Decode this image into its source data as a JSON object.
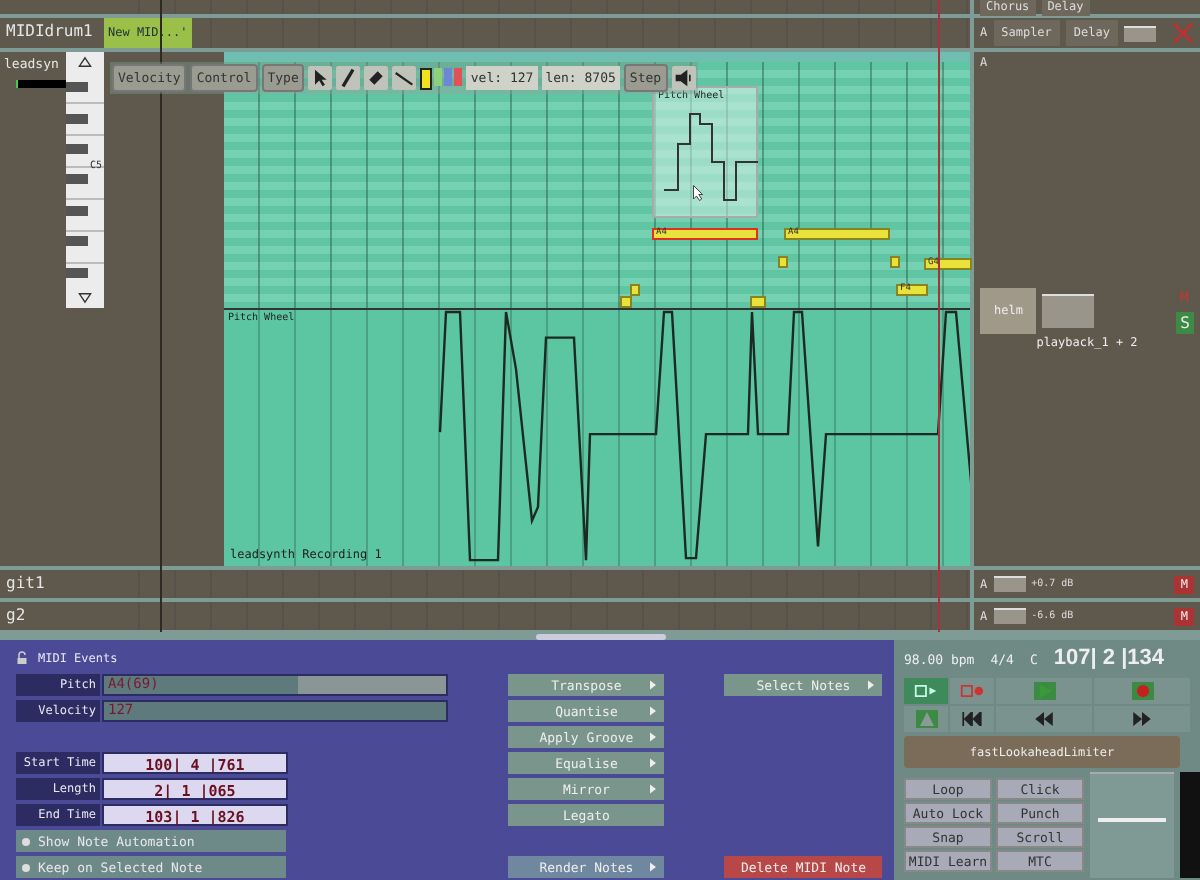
{
  "top_track": {
    "plugins": [
      "Chorus",
      "Delay"
    ]
  },
  "midi_drum_track": {
    "name": "MIDIdrum1",
    "clip": "New MID...'",
    "auto": "A",
    "plugins": [
      "Sampler",
      "Delay"
    ]
  },
  "lead_track": {
    "name": "leadsyn",
    "key_label": "C5",
    "auto": "A",
    "toolbar": {
      "modes": [
        {
          "label": "Velocity",
          "selected": false
        },
        {
          "label": "Control",
          "selected": false
        },
        {
          "label": "Type",
          "selected": false
        }
      ],
      "swatches": [
        {
          "color": "#f2e21c",
          "selected": true
        },
        {
          "color": "#8fd07a",
          "selected": false
        },
        {
          "color": "#6d86d6",
          "selected": false
        },
        {
          "color": "#e0525a",
          "selected": false
        }
      ],
      "velocity": "vel: 127",
      "length": "len: 8705",
      "step": "Step"
    },
    "notes": [
      {
        "label": "A4",
        "selected": true
      },
      {
        "label": "A4",
        "selected": false
      },
      {
        "label": "G4",
        "selected": false
      },
      {
        "label": "F4",
        "selected": false
      }
    ],
    "popup_title": "Pitch Wheel",
    "lane_title": "Pitch Wheel",
    "clip_name": "leadsynth Recording 1",
    "mixer": {
      "plugin": "helm",
      "mute": "M",
      "solo": "S",
      "output": "playback_1 + 2"
    }
  },
  "audio_tracks": [
    {
      "name": "git1",
      "auto": "A",
      "gain": "+0.7 dB",
      "mute": "M"
    },
    {
      "name": "g2",
      "auto": "A",
      "gain": "-6.6 dB",
      "mute": "M"
    }
  ],
  "midi_events": {
    "title": "MIDI Events",
    "sliders": [
      {
        "label": "Pitch",
        "value": "A4(69)",
        "level": 0.57
      },
      {
        "label": "Velocity",
        "value": "127",
        "level": 1
      }
    ],
    "times": [
      {
        "label": "Start Time",
        "value": "100| 4 |761"
      },
      {
        "label": "Length",
        "value": "2| 1 |065"
      },
      {
        "label": "End Time",
        "value": "103| 1 |826"
      }
    ],
    "options": [
      "Show Note Automation",
      "Keep on Selected Note"
    ],
    "actions": [
      {
        "label": "Transpose",
        "submenu": true
      },
      {
        "label": "Quantise",
        "submenu": true
      },
      {
        "label": "Apply Groove",
        "submenu": true
      },
      {
        "label": "Equalise",
        "submenu": true
      },
      {
        "label": "Mirror",
        "submenu": true
      },
      {
        "label": "Legato",
        "submenu": false
      }
    ],
    "render": "Render Notes",
    "select": "Select Notes",
    "delete": "Delete MIDI Note"
  },
  "transport": {
    "tempo": "98.00 bpm",
    "meter": "4/4",
    "key": "C",
    "position": "107| 2 |134",
    "plugin": "fastLookaheadLimiter",
    "buttons": [
      "Loop",
      "Click",
      "Auto Lock",
      "Punch",
      "Snap",
      "Scroll",
      "MIDI Learn",
      "MTC"
    ]
  }
}
